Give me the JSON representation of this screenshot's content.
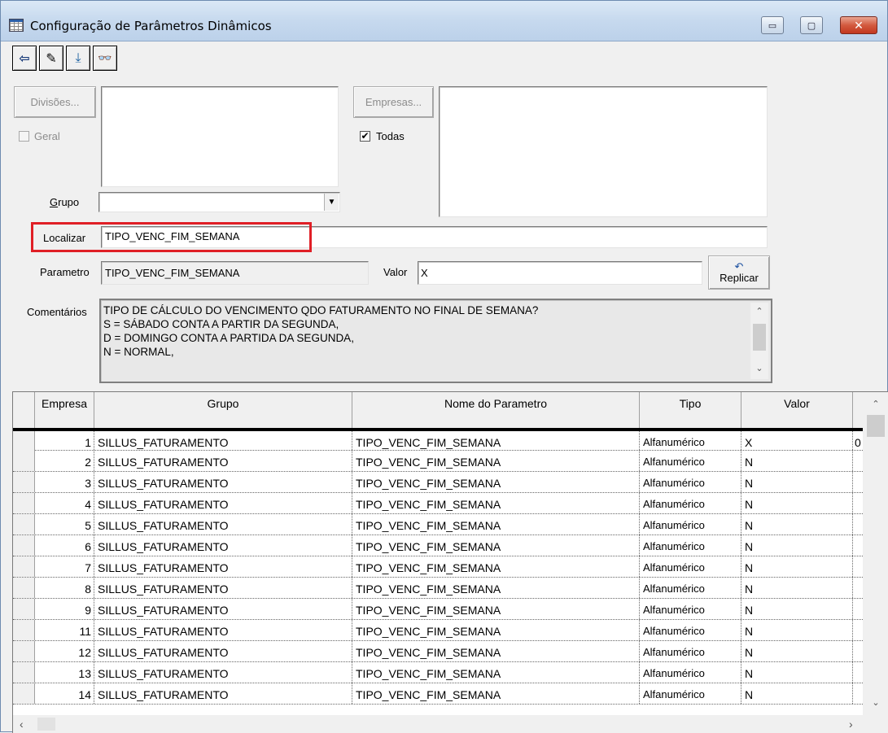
{
  "window": {
    "title": "Configuração de Parâmetros Dinâmicos",
    "controls": {
      "minimize": "▭",
      "maximize": "▢",
      "close": "✕"
    }
  },
  "toolbar": {
    "buttons": [
      {
        "name": "exit-button",
        "icon": "exit-door-icon",
        "glyph": "⇦"
      },
      {
        "name": "clear-button",
        "icon": "eraser-icon",
        "glyph": "✎"
      },
      {
        "name": "save-button",
        "icon": "save-download-icon",
        "glyph": "⤓"
      },
      {
        "name": "search-button",
        "icon": "binoculars-icon",
        "glyph": "👓"
      }
    ]
  },
  "filters": {
    "divisoes_button": "Divisões...",
    "geral_label": "Geral",
    "geral_checked": false,
    "empresas_button": "Empresas...",
    "todas_label": "Todas",
    "todas_checked": true,
    "grupo_label": "Grupo",
    "grupo_value": ""
  },
  "search": {
    "localizar_label": "Localizar",
    "localizar_value": "TIPO_VENC_FIM_SEMANA"
  },
  "detail": {
    "parametro_label": "Parametro",
    "parametro_value": "TIPO_VENC_FIM_SEMANA",
    "valor_label": "Valor",
    "valor_value": "X",
    "replicar_button": "Replicar",
    "comentarios_label": "Comentários",
    "comentarios_lines": [
      "TIPO DE CÁLCULO DO VENCIMENTO QDO FATURAMENTO NO FINAL DE SEMANA?",
      "S = SÁBADO CONTA A PARTIR DA SEGUNDA,",
      "D = DOMINGO CONTA A PARTIDA DA SEGUNDA,",
      "N = NORMAL,"
    ]
  },
  "grid": {
    "columns": [
      "Empresa",
      "Grupo",
      "Nome do Parametro",
      "Tipo",
      "Valor"
    ],
    "rows": [
      {
        "empresa": "1",
        "grupo": "SILLUS_FATURAMENTO",
        "nome": "TIPO_VENC_FIM_SEMANA",
        "tipo": "Alfanumérico",
        "valor": "X",
        "extra": "0"
      },
      {
        "empresa": "2",
        "grupo": "SILLUS_FATURAMENTO",
        "nome": "TIPO_VENC_FIM_SEMANA",
        "tipo": "Alfanumérico",
        "valor": "N",
        "extra": ""
      },
      {
        "empresa": "3",
        "grupo": "SILLUS_FATURAMENTO",
        "nome": "TIPO_VENC_FIM_SEMANA",
        "tipo": "Alfanumérico",
        "valor": "N",
        "extra": ""
      },
      {
        "empresa": "4",
        "grupo": "SILLUS_FATURAMENTO",
        "nome": "TIPO_VENC_FIM_SEMANA",
        "tipo": "Alfanumérico",
        "valor": "N",
        "extra": ""
      },
      {
        "empresa": "5",
        "grupo": "SILLUS_FATURAMENTO",
        "nome": "TIPO_VENC_FIM_SEMANA",
        "tipo": "Alfanumérico",
        "valor": "N",
        "extra": ""
      },
      {
        "empresa": "6",
        "grupo": "SILLUS_FATURAMENTO",
        "nome": "TIPO_VENC_FIM_SEMANA",
        "tipo": "Alfanumérico",
        "valor": "N",
        "extra": ""
      },
      {
        "empresa": "7",
        "grupo": "SILLUS_FATURAMENTO",
        "nome": "TIPO_VENC_FIM_SEMANA",
        "tipo": "Alfanumérico",
        "valor": "N",
        "extra": ""
      },
      {
        "empresa": "8",
        "grupo": "SILLUS_FATURAMENTO",
        "nome": "TIPO_VENC_FIM_SEMANA",
        "tipo": "Alfanumérico",
        "valor": "N",
        "extra": ""
      },
      {
        "empresa": "9",
        "grupo": "SILLUS_FATURAMENTO",
        "nome": "TIPO_VENC_FIM_SEMANA",
        "tipo": "Alfanumérico",
        "valor": "N",
        "extra": ""
      },
      {
        "empresa": "11",
        "grupo": "SILLUS_FATURAMENTO",
        "nome": "TIPO_VENC_FIM_SEMANA",
        "tipo": "Alfanumérico",
        "valor": "N",
        "extra": ""
      },
      {
        "empresa": "12",
        "grupo": "SILLUS_FATURAMENTO",
        "nome": "TIPO_VENC_FIM_SEMANA",
        "tipo": "Alfanumérico",
        "valor": "N",
        "extra": ""
      },
      {
        "empresa": "13",
        "grupo": "SILLUS_FATURAMENTO",
        "nome": "TIPO_VENC_FIM_SEMANA",
        "tipo": "Alfanumérico",
        "valor": "N",
        "extra": ""
      },
      {
        "empresa": "14",
        "grupo": "SILLUS_FATURAMENTO",
        "nome": "TIPO_VENC_FIM_SEMANA",
        "tipo": "Alfanumérico",
        "valor": "N",
        "extra": ""
      }
    ]
  },
  "colors": {
    "highlight": "#e01f26",
    "titlebar": "#c6d9ee",
    "close_button": "#c2381f"
  }
}
